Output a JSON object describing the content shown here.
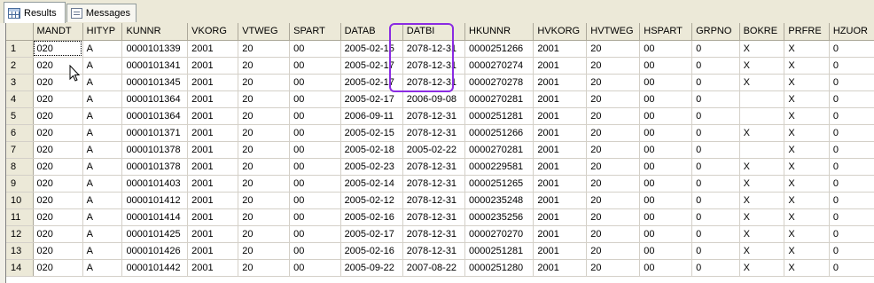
{
  "tabs": [
    {
      "label": "Results",
      "icon": "grid-icon"
    },
    {
      "label": "Messages",
      "icon": "messages-icon"
    }
  ],
  "grid": {
    "columns": [
      "MANDT",
      "HITYP",
      "KUNNR",
      "VKORG",
      "VTWEG",
      "SPART",
      "DATAB",
      "DATBI",
      "HKUNNR",
      "HVKORG",
      "HVTWEG",
      "HSPART",
      "GRPNO",
      "BOKRE",
      "PRFRE",
      "HZUOR"
    ],
    "rows": [
      [
        "1",
        "020",
        "A",
        "0000101339",
        "2001",
        "20",
        "00",
        "2005-02-15",
        "2078-12-31",
        "0000251266",
        "2001",
        "20",
        "00",
        "0",
        "X",
        "X",
        "0"
      ],
      [
        "2",
        "020",
        "A",
        "0000101341",
        "2001",
        "20",
        "00",
        "2005-02-17",
        "2078-12-31",
        "0000270274",
        "2001",
        "20",
        "00",
        "0",
        "X",
        "X",
        "0"
      ],
      [
        "3",
        "020",
        "A",
        "0000101345",
        "2001",
        "20",
        "00",
        "2005-02-17",
        "2078-12-31",
        "0000270278",
        "2001",
        "20",
        "00",
        "0",
        "X",
        "X",
        "0"
      ],
      [
        "4",
        "020",
        "A",
        "0000101364",
        "2001",
        "20",
        "00",
        "2005-02-17",
        "2006-09-08",
        "0000270281",
        "2001",
        "20",
        "00",
        "0",
        "",
        "X",
        "0"
      ],
      [
        "5",
        "020",
        "A",
        "0000101364",
        "2001",
        "20",
        "00",
        "2006-09-11",
        "2078-12-31",
        "0000251281",
        "2001",
        "20",
        "00",
        "0",
        "",
        "X",
        "0"
      ],
      [
        "6",
        "020",
        "A",
        "0000101371",
        "2001",
        "20",
        "00",
        "2005-02-15",
        "2078-12-31",
        "0000251266",
        "2001",
        "20",
        "00",
        "0",
        "X",
        "X",
        "0"
      ],
      [
        "7",
        "020",
        "A",
        "0000101378",
        "2001",
        "20",
        "00",
        "2005-02-18",
        "2005-02-22",
        "0000270281",
        "2001",
        "20",
        "00",
        "0",
        "",
        "X",
        "0"
      ],
      [
        "8",
        "020",
        "A",
        "0000101378",
        "2001",
        "20",
        "00",
        "2005-02-23",
        "2078-12-31",
        "0000229581",
        "2001",
        "20",
        "00",
        "0",
        "X",
        "X",
        "0"
      ],
      [
        "9",
        "020",
        "A",
        "0000101403",
        "2001",
        "20",
        "00",
        "2005-02-14",
        "2078-12-31",
        "0000251265",
        "2001",
        "20",
        "00",
        "0",
        "X",
        "X",
        "0"
      ],
      [
        "10",
        "020",
        "A",
        "0000101412",
        "2001",
        "20",
        "00",
        "2005-02-12",
        "2078-12-31",
        "0000235248",
        "2001",
        "20",
        "00",
        "0",
        "X",
        "X",
        "0"
      ],
      [
        "11",
        "020",
        "A",
        "0000101414",
        "2001",
        "20",
        "00",
        "2005-02-16",
        "2078-12-31",
        "0000235256",
        "2001",
        "20",
        "00",
        "0",
        "X",
        "X",
        "0"
      ],
      [
        "12",
        "020",
        "A",
        "0000101425",
        "2001",
        "20",
        "00",
        "2005-02-17",
        "2078-12-31",
        "0000270270",
        "2001",
        "20",
        "00",
        "0",
        "X",
        "X",
        "0"
      ],
      [
        "13",
        "020",
        "A",
        "0000101426",
        "2001",
        "20",
        "00",
        "2005-02-16",
        "2078-12-31",
        "0000251281",
        "2001",
        "20",
        "00",
        "0",
        "X",
        "X",
        "0"
      ],
      [
        "14",
        "020",
        "A",
        "0000101442",
        "2001",
        "20",
        "00",
        "2005-09-22",
        "2007-08-22",
        "0000251280",
        "2001",
        "20",
        "00",
        "0",
        "X",
        "X",
        "0"
      ]
    ]
  },
  "colors": {
    "highlight": "#8a2be2",
    "header_bg": "#ece9d8",
    "grid_line": "#d4d0c8"
  },
  "highlighted_column": "DATBI"
}
